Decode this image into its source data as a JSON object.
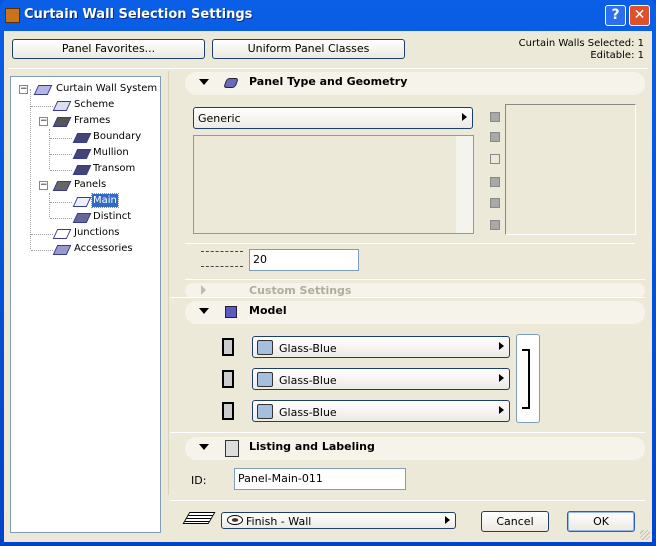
{
  "window": {
    "title": "Curtain Wall Selection Settings",
    "help_label": "?",
    "close_label": "✕"
  },
  "toolbar": {
    "panel_favorites": "Panel Favorites...",
    "uniform_panel_classes": "Uniform Panel Classes"
  },
  "status": {
    "selected": "Curtain Walls Selected: 1",
    "editable": "Editable: 1"
  },
  "tree": {
    "items": [
      {
        "label": "Curtain Wall System"
      },
      {
        "label": "Scheme"
      },
      {
        "label": "Frames"
      },
      {
        "label": "Boundary"
      },
      {
        "label": "Mullion"
      },
      {
        "label": "Transom"
      },
      {
        "label": "Panels"
      },
      {
        "label": "Main",
        "selected": true
      },
      {
        "label": "Distinct"
      },
      {
        "label": "Junctions"
      },
      {
        "label": "Accessories"
      }
    ]
  },
  "sections": {
    "panel_type": {
      "title": "Panel Type and Geometry",
      "type_value": "Generic",
      "thickness_value": "20"
    },
    "custom": {
      "title": "Custom Settings"
    },
    "model": {
      "title": "Model",
      "materials": [
        "Glass-Blue",
        "Glass-Blue",
        "Glass-Blue"
      ],
      "swatch_color": "#a6bfdc"
    },
    "listing": {
      "title": "Listing and Labeling",
      "id_label": "ID:",
      "id_value": "Panel-Main-011"
    }
  },
  "footer": {
    "layer_value": "Finish - Wall",
    "cancel": "Cancel",
    "ok": "OK"
  }
}
